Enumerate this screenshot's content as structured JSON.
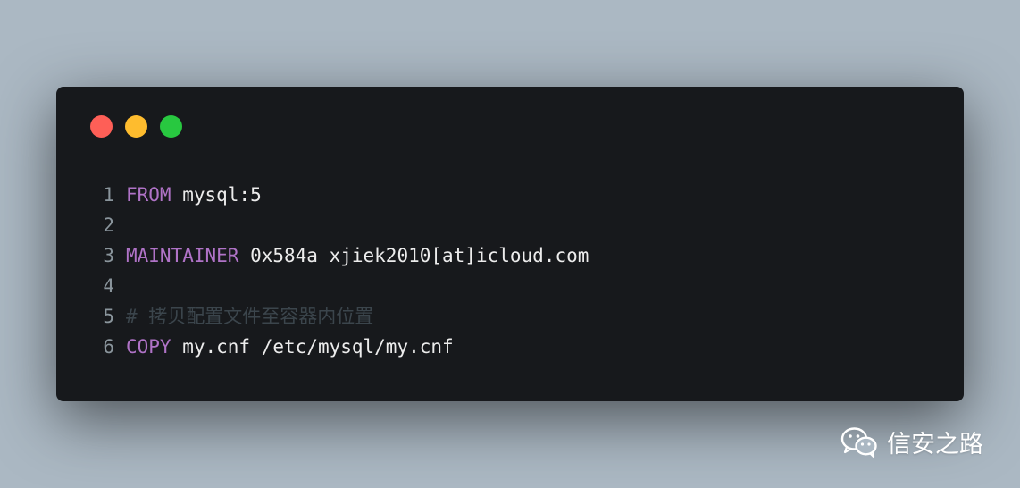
{
  "window_controls": {
    "close_color": "#fe5f57",
    "minimize_color": "#febc2e",
    "maximize_color": "#28c840"
  },
  "code_lines": [
    {
      "num": "1",
      "keyword": "FROM",
      "rest": " mysql:5",
      "comment": ""
    },
    {
      "num": "2",
      "keyword": "",
      "rest": "",
      "comment": ""
    },
    {
      "num": "3",
      "keyword": "MAINTAINER",
      "rest": " 0x584a xjiek2010[at]icloud.com",
      "comment": ""
    },
    {
      "num": "4",
      "keyword": "",
      "rest": "",
      "comment": ""
    },
    {
      "num": "5",
      "keyword": "",
      "rest": "",
      "comment": "# 拷贝配置文件至容器内位置"
    },
    {
      "num": "6",
      "keyword": "COPY",
      "rest": " my.cnf /etc/mysql/my.cnf",
      "comment": ""
    }
  ],
  "watermark": {
    "icon": "wechat-icon",
    "text": "信安之路"
  }
}
